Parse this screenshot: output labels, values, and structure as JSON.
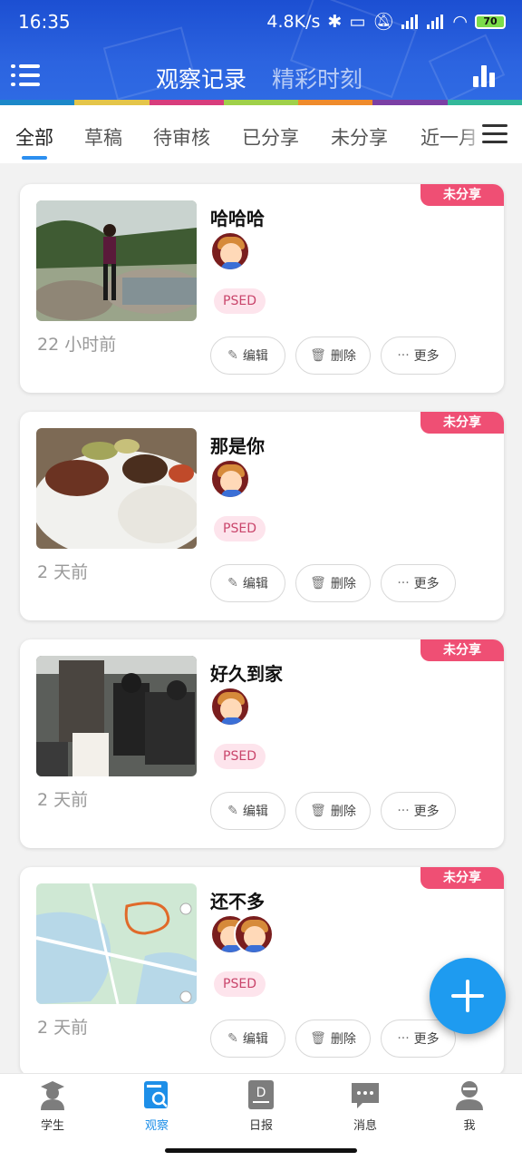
{
  "status_bar": {
    "time": "16:35",
    "net_speed": "4.8K/s",
    "battery": "70"
  },
  "header": {
    "title": "观察记录",
    "subtitle": "精彩时刻"
  },
  "tabs": [
    "全部",
    "草稿",
    "待审核",
    "已分享",
    "未分享",
    "近一月"
  ],
  "cards": [
    {
      "title": "哈哈哈",
      "time": "22 小时前",
      "badge": "未分享",
      "tag": "PSED",
      "edit": "编辑",
      "delete": "删除",
      "more": "更多"
    },
    {
      "title": "那是你",
      "time": "2 天前",
      "badge": "未分享",
      "tag": "PSED",
      "edit": "编辑",
      "delete": "删除",
      "more": "更多"
    },
    {
      "title": "好久到家",
      "time": "2 天前",
      "badge": "未分享",
      "tag": "PSED",
      "edit": "编辑",
      "delete": "删除",
      "more": "更多"
    },
    {
      "title": "还不多",
      "time": "2 天前",
      "badge": "未分享",
      "tag": "PSED",
      "edit": "编辑",
      "delete": "删除",
      "more": "更多"
    }
  ],
  "bottom_nav": [
    "学生",
    "观察",
    "日报",
    "消息",
    "我"
  ],
  "colors": {
    "header_blue": "#2c64e0",
    "accent": "#1e9bf0",
    "badge_pink": "#ef4f74",
    "tag_bg": "#fde4ec"
  }
}
